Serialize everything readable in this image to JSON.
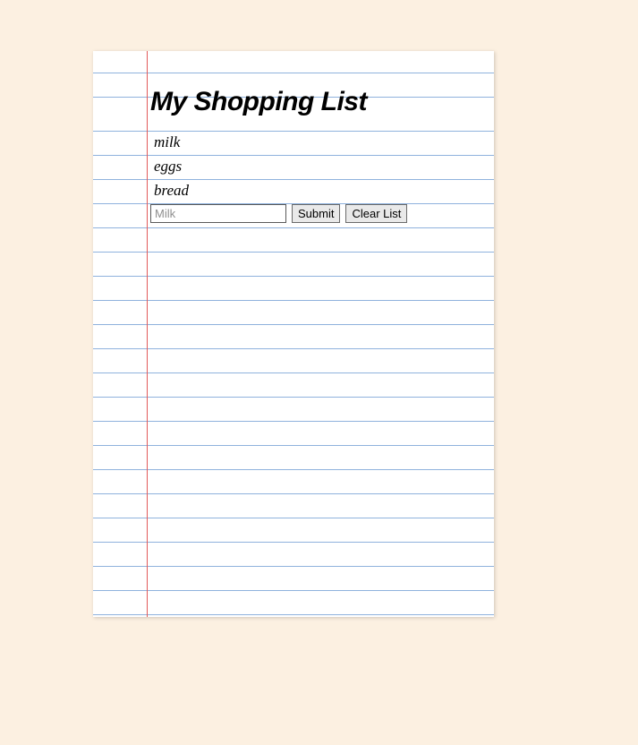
{
  "title": "My Shopping List",
  "items": [
    "milk",
    "eggs",
    "bread"
  ],
  "form": {
    "input_placeholder": "Milk",
    "input_value": "",
    "submit_label": "Submit",
    "clear_label": "Clear List"
  }
}
